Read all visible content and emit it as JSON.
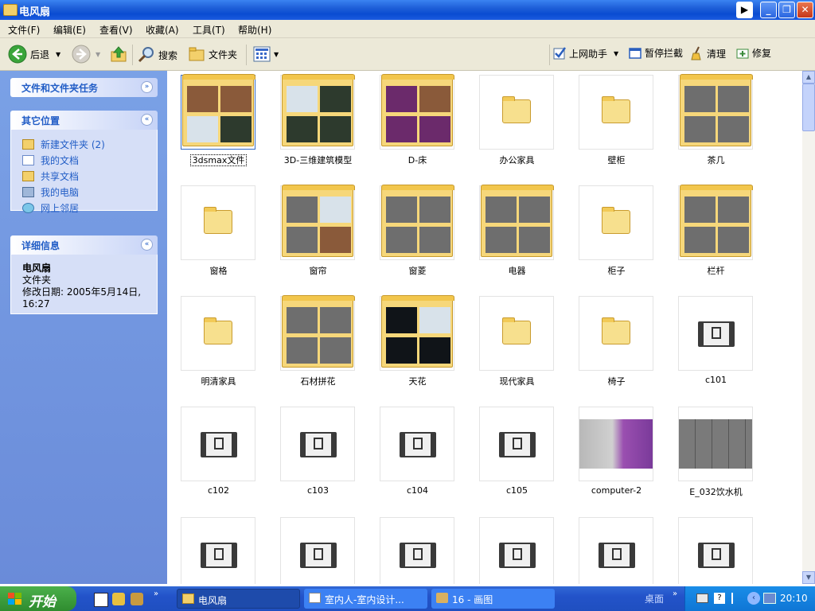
{
  "window": {
    "title": "电风扇"
  },
  "menubar": [
    "文件(F)",
    "编辑(E)",
    "查看(V)",
    "收藏(A)",
    "工具(T)",
    "帮助(H)"
  ],
  "toolbar": {
    "back": "后退",
    "search": "搜索",
    "folders": "文件夹",
    "assistant": "上网助手",
    "block": "暂停拦截",
    "clean": "清理",
    "repair": "修复"
  },
  "leftpane": {
    "tasks_title": "文件和文件夹任务",
    "places_title": "其它位置",
    "places": [
      "新建文件夹 (2)",
      "我的文档",
      "共享文档",
      "我的电脑",
      "网上邻居"
    ],
    "details_title": "详细信息",
    "details": {
      "name": "电风扇",
      "type": "文件夹",
      "modified": "修改日期: 2005年5月14日,",
      "modified_time": "16:27"
    }
  },
  "items": [
    {
      "label": "3dsmax文件",
      "kind": "thumbfolder",
      "style": "room",
      "selected": true
    },
    {
      "label": "3D-三维建筑模型",
      "kind": "thumbfolder",
      "style": "arch"
    },
    {
      "label": "D-床",
      "kind": "thumbfolder",
      "style": "purple"
    },
    {
      "label": "办公家具",
      "kind": "folder"
    },
    {
      "label": "壁柜",
      "kind": "folder"
    },
    {
      "label": "茶几",
      "kind": "thumbfolder",
      "style": "gray"
    },
    {
      "label": "窗格",
      "kind": "folder"
    },
    {
      "label": "窗帘",
      "kind": "thumbfolder",
      "style": "mixed"
    },
    {
      "label": "窗菱",
      "kind": "thumbfolder",
      "style": "gray"
    },
    {
      "label": "电器",
      "kind": "thumbfolder",
      "style": "gray"
    },
    {
      "label": "柜子",
      "kind": "folder"
    },
    {
      "label": "栏杆",
      "kind": "thumbfolder",
      "style": "gray"
    },
    {
      "label": "明清家具",
      "kind": "folder"
    },
    {
      "label": "石材拼花",
      "kind": "thumbfolder",
      "style": "gray"
    },
    {
      "label": "天花",
      "kind": "thumbfolder",
      "style": "black"
    },
    {
      "label": "现代家具",
      "kind": "folder"
    },
    {
      "label": "椅子",
      "kind": "folder"
    },
    {
      "label": "c101",
      "kind": "max"
    },
    {
      "label": "c102",
      "kind": "max"
    },
    {
      "label": "c103",
      "kind": "max"
    },
    {
      "label": "c104",
      "kind": "max"
    },
    {
      "label": "c105",
      "kind": "max"
    },
    {
      "label": "computer-2",
      "kind": "image",
      "style": "computer"
    },
    {
      "label": "E_032饮水机",
      "kind": "image",
      "style": "cad"
    },
    {
      "label": "",
      "kind": "max"
    },
    {
      "label": "",
      "kind": "max"
    },
    {
      "label": "",
      "kind": "max"
    },
    {
      "label": "",
      "kind": "max"
    },
    {
      "label": "",
      "kind": "max"
    },
    {
      "label": "",
      "kind": "max"
    }
  ],
  "taskbar": {
    "start": "开始",
    "tasks": [
      "电风扇",
      "室内人-室内设计...",
      "16 - 画图"
    ],
    "desktop": "桌面",
    "clock": "20:10"
  }
}
